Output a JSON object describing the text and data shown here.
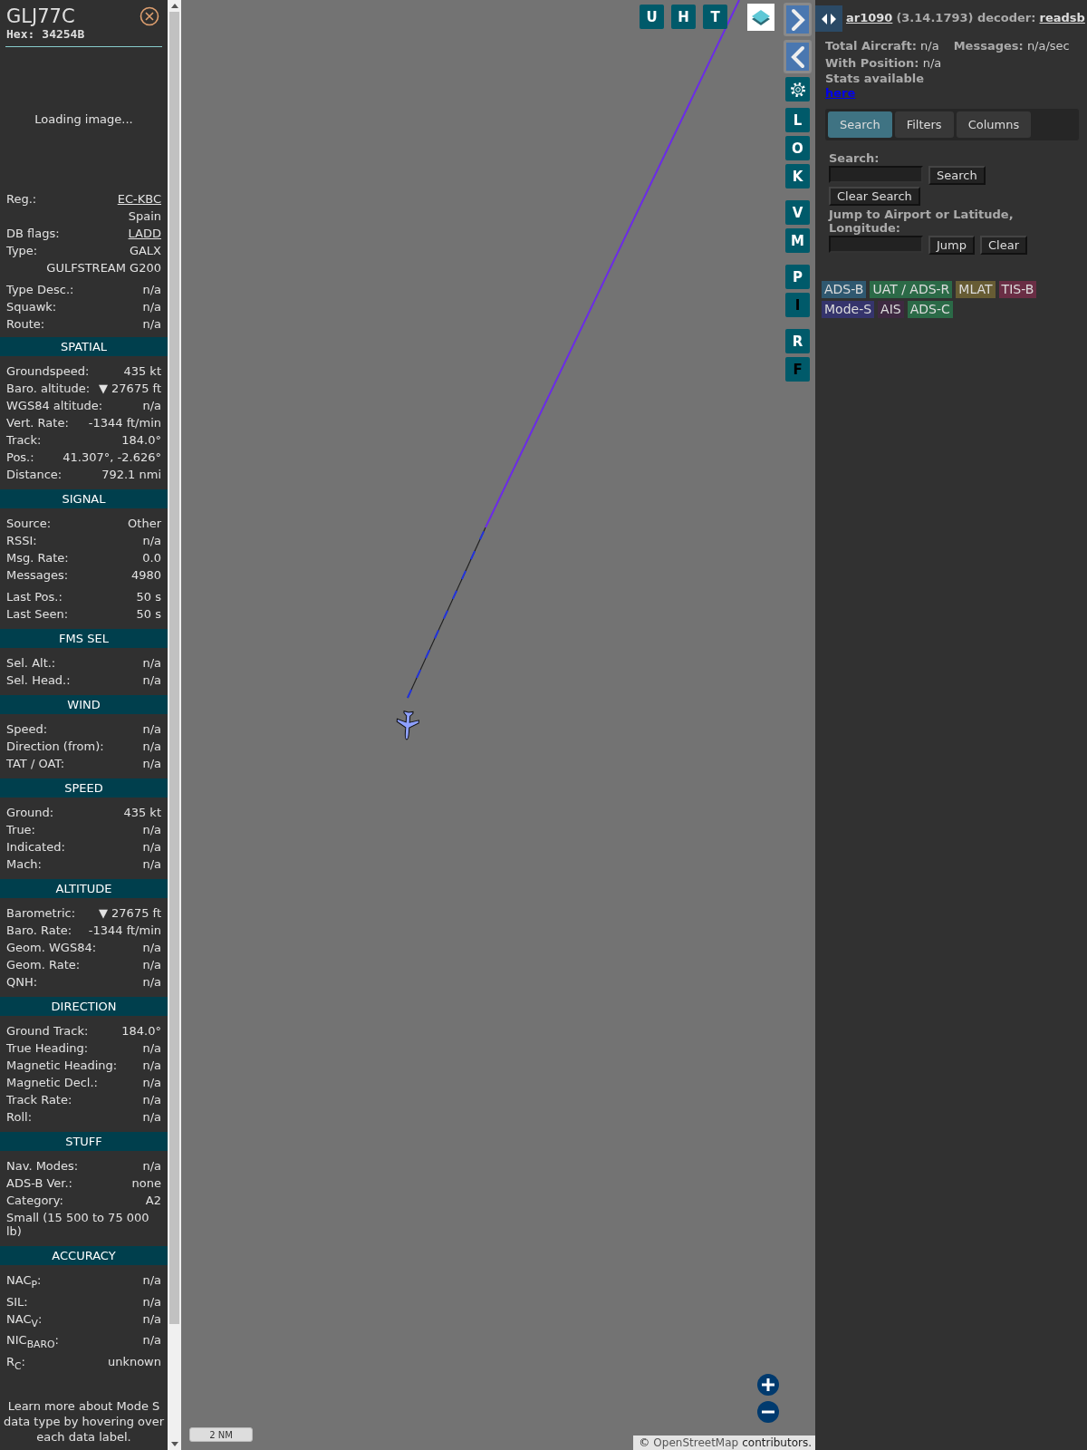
{
  "aircraft": {
    "callsign": "GLJ77C",
    "hex_label": "Hex:",
    "hex": "34254B",
    "photo_status": "Loading image...",
    "groups": [
      [
        {
          "kind": "link",
          "label": "Reg.:",
          "value": "EC-KBC"
        },
        {
          "kind": "continuation",
          "value": "Spain"
        },
        {
          "kind": "link",
          "label": "DB flags:",
          "value": "LADD"
        },
        {
          "kind": "plain",
          "label": "Type:",
          "value": "GALX"
        },
        {
          "kind": "continuation",
          "value": "GULFSTREAM G200"
        }
      ],
      [
        {
          "kind": "plain",
          "label": "Type Desc.:",
          "value": "n/a"
        },
        {
          "kind": "plain",
          "label": "Squawk:",
          "value": "n/a"
        },
        {
          "kind": "plain",
          "label": "Route:",
          "value": "n/a"
        }
      ]
    ]
  },
  "sections": [
    {
      "title": "SPATIAL",
      "groups": [
        [
          {
            "kind": "plain",
            "label": "Groundspeed:",
            "value": "435 kt"
          },
          {
            "kind": "plain",
            "label": "Baro. altitude:",
            "value": "▼ 27675 ft"
          },
          {
            "kind": "plain",
            "label": "WGS84 altitude:",
            "value": "n/a"
          },
          {
            "kind": "plain",
            "label": "Vert. Rate:",
            "value": "-1344 ft/min"
          },
          {
            "kind": "plain",
            "label": "Track:",
            "value": "184.0°"
          },
          {
            "kind": "plain",
            "label": "Pos.:",
            "value": "41.307°, -2.626°"
          },
          {
            "kind": "plain",
            "label": "Distance:",
            "value": "792.1 nmi"
          }
        ]
      ]
    },
    {
      "title": "SIGNAL",
      "groups": [
        [
          {
            "kind": "plain",
            "label": "Source:",
            "value": "Other"
          },
          {
            "kind": "plain",
            "label": "RSSI:",
            "value": "n/a"
          },
          {
            "kind": "plain",
            "label": "Msg. Rate:",
            "value": "0.0"
          },
          {
            "kind": "plain",
            "label": "Messages:",
            "value": "4980"
          }
        ],
        [
          {
            "kind": "plain",
            "label": "Last Pos.:",
            "value": "50 s"
          },
          {
            "kind": "plain",
            "label": "Last Seen:",
            "value": "50 s"
          }
        ]
      ]
    },
    {
      "title": "FMS SEL",
      "groups": [
        [
          {
            "kind": "plain",
            "label": "Sel. Alt.:",
            "value": "n/a"
          },
          {
            "kind": "plain",
            "label": "Sel. Head.:",
            "value": "n/a"
          }
        ]
      ]
    },
    {
      "title": "WIND",
      "groups": [
        [
          {
            "kind": "plain",
            "label": "Speed:",
            "value": "n/a"
          },
          {
            "kind": "plain",
            "label": "Direction (from):",
            "value": "n/a"
          },
          {
            "kind": "plain",
            "label": "TAT / OAT:",
            "value": "n/a"
          }
        ]
      ]
    },
    {
      "title": "SPEED",
      "groups": [
        [
          {
            "kind": "plain",
            "label": "Ground:",
            "value": "435 kt"
          },
          {
            "kind": "plain",
            "label": "True:",
            "value": "n/a"
          },
          {
            "kind": "plain",
            "label": "Indicated:",
            "value": "n/a"
          },
          {
            "kind": "plain",
            "label": "Mach:",
            "value": "n/a"
          }
        ]
      ]
    },
    {
      "title": "ALTITUDE",
      "groups": [
        [
          {
            "kind": "plain",
            "label": "Barometric:",
            "value": "▼ 27675 ft"
          },
          {
            "kind": "plain",
            "label": "Baro. Rate:",
            "value": "-1344 ft/min"
          },
          {
            "kind": "plain",
            "label": "Geom. WGS84:",
            "value": "n/a"
          },
          {
            "kind": "plain",
            "label": "Geom. Rate:",
            "value": "n/a"
          },
          {
            "kind": "plain",
            "label": "QNH:",
            "value": "n/a"
          }
        ]
      ]
    },
    {
      "title": "DIRECTION",
      "groups": [
        [
          {
            "kind": "plain",
            "label": "Ground Track:",
            "value": "184.0°"
          },
          {
            "kind": "plain",
            "label": "True Heading:",
            "value": "n/a"
          },
          {
            "kind": "plain",
            "label": "Magnetic Heading:",
            "value": "n/a"
          },
          {
            "kind": "plain",
            "label": "Magnetic Decl.:",
            "value": "n/a"
          },
          {
            "kind": "plain",
            "label": "Track Rate:",
            "value": "n/a"
          },
          {
            "kind": "plain",
            "label": "Roll:",
            "value": "n/a"
          }
        ]
      ]
    },
    {
      "title": "STUFF",
      "groups": [
        [
          {
            "kind": "plain",
            "label": "Nav. Modes:",
            "value": "n/a"
          },
          {
            "kind": "plain",
            "label": "ADS-B Ver.:",
            "value": "none"
          },
          {
            "kind": "plain",
            "label": "Category:",
            "value": "A2"
          },
          {
            "kind": "note",
            "value": "Small (15 500 to 75 000 lb)"
          }
        ]
      ]
    },
    {
      "title": "ACCURACY",
      "groups": [
        [
          {
            "kind": "plain",
            "label": "NAC$_{P}$:",
            "value": "n/a"
          },
          {
            "kind": "plain",
            "label": "SIL:",
            "value": "n/a"
          },
          {
            "kind": "plain",
            "label": "NAC$_{V}$:",
            "value": "n/a"
          },
          {
            "kind": "plain",
            "label": "NIC$_{BARO}$:",
            "value": "n/a"
          },
          {
            "kind": "plain",
            "label": "R$_{C}$:",
            "value": "unknown"
          }
        ]
      ]
    }
  ],
  "footer_note": "Learn more about Mode S data type by hovering over each data label.",
  "map": {
    "top_buttons": [
      {
        "label": "U",
        "on": true
      },
      {
        "label": "H",
        "on": true
      },
      {
        "label": "T",
        "on": true
      }
    ],
    "side_groups": [
      [
        {
          "label": "L",
          "on": true
        },
        {
          "label": "O",
          "on": true
        },
        {
          "label": "K",
          "on": true
        }
      ],
      [
        {
          "label": "V",
          "on": true
        },
        {
          "label": "M",
          "on": true
        }
      ],
      [
        {
          "label": "P",
          "on": true
        },
        {
          "label": "I",
          "on": false
        }
      ],
      [
        {
          "label": "R",
          "on": true
        },
        {
          "label": "F",
          "on": false
        }
      ]
    ],
    "scale": "2 NM",
    "attribution_prefix": "©",
    "attribution_source": "OpenStreetMap",
    "attribution_rest": "contributors."
  },
  "header": {
    "app_link": "ar1090",
    "version": "(3.14.1793) decoder:",
    "decoder_link": "readsb"
  },
  "stats": [
    {
      "label": "Total Aircraft:",
      "value": "n/a"
    },
    {
      "label": "Messages:",
      "value": "n/a/sec"
    },
    {
      "label": "With Position:",
      "value": "n/a"
    }
  ],
  "stats_note": "Stats available",
  "stats_link": "here",
  "tabs": [
    {
      "label": "Search",
      "selected": true
    },
    {
      "label": "Filters",
      "selected": false
    },
    {
      "label": "Columns",
      "selected": false
    }
  ],
  "search": {
    "label": "Search:",
    "button": "Search",
    "clear_button": "Clear Search",
    "jump_label": "Jump to Airport or Latitude, Longitude:",
    "jump_button": "Jump",
    "jump_clear_button": "Clear"
  },
  "legend": [
    [
      {
        "label": "ADS-B",
        "color": "#2f5870"
      },
      {
        "label": "UAT / ADS-R",
        "color": "#2b6a47"
      },
      {
        "label": "MLAT",
        "color": "#675c34"
      },
      {
        "label": "TIS-B",
        "color": "#6a2e45"
      }
    ],
    [
      {
        "label": "Mode-S",
        "color": "#35346c"
      },
      {
        "label": "AIS",
        "color": "#3e2941"
      },
      {
        "label": "ADS-C",
        "color": "#2b6a47"
      }
    ]
  ]
}
